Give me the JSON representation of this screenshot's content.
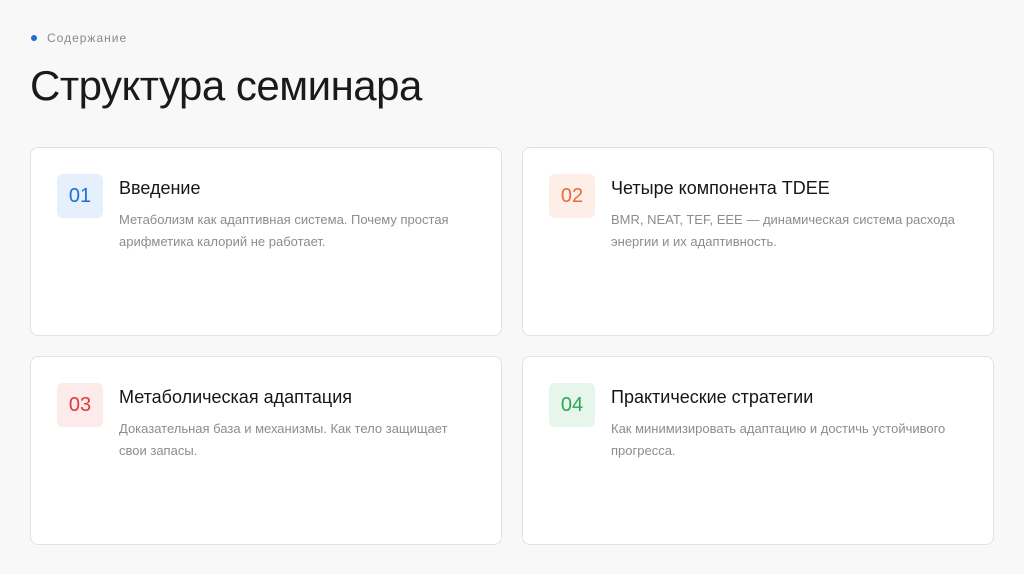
{
  "header": {
    "eyebrow": "Содержание",
    "title": "Структура семинара"
  },
  "colors": {
    "accent": "#1f6fd1",
    "badge_blue": "#1f6fd1",
    "badge_orange": "#ec6a3b",
    "badge_red": "#df3a3a",
    "badge_green": "#2fa653"
  },
  "cards": [
    {
      "number": "01",
      "title": "Введение",
      "description": "Метаболизм как адаптивная система. Почему простая арифметика калорий не работает."
    },
    {
      "number": "02",
      "title": "Четыре компонента TDEE",
      "description": "BMR, NEAT, TEF, EEE — динамическая система расхода энергии и их адаптивность."
    },
    {
      "number": "03",
      "title": "Метаболическая адаптация",
      "description": "Доказательная база и механизмы. Как тело защищает свои запасы."
    },
    {
      "number": "04",
      "title": "Практические стратегии",
      "description": "Как минимизировать адаптацию и достичь устойчивого прогресса."
    }
  ]
}
